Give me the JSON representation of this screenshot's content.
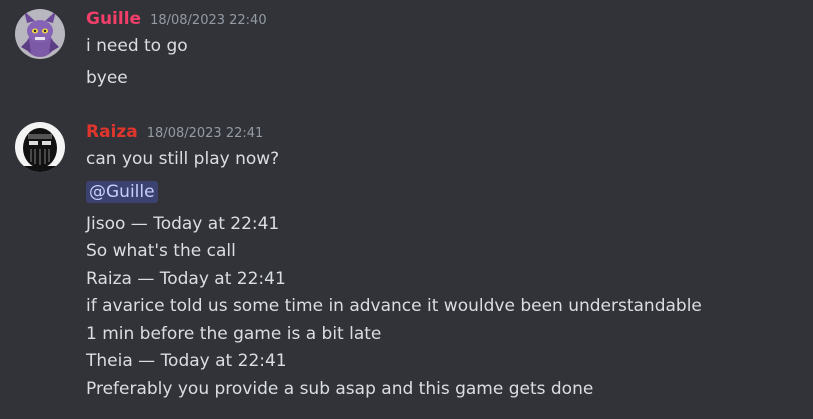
{
  "messages": [
    {
      "author": "Guille",
      "author_color": "#f23f6a",
      "timestamp": "18/08/2023 22:40",
      "avatar_icon": "purple-creature-avatar",
      "lines": [
        "i need to go",
        "byee"
      ]
    },
    {
      "author": "Raiza",
      "author_color": "#e0352d",
      "timestamp": "18/08/2023 22:41",
      "avatar_icon": "masked-figure-avatar",
      "lines": [
        "can you still play now?",
        "@Guille",
        "Jisoo — Today at 22:41",
        "So what's the call",
        "Raiza — Today at 22:41",
        "if avarice told us some time in advance it wouldve been understandable",
        "1 min before the game is a bit late",
        "Theia — Today at 22:41",
        "Preferably you provide a sub asap and this game gets done"
      ]
    }
  ]
}
